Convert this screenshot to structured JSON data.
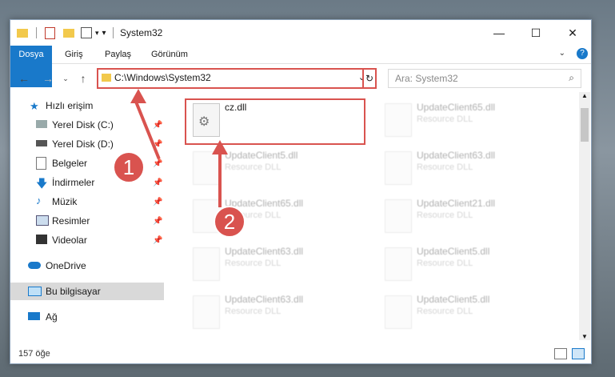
{
  "window": {
    "title": "System32"
  },
  "ribbon": {
    "tabs": [
      "Dosya",
      "Giriş",
      "Paylaş",
      "Görünüm"
    ]
  },
  "address": {
    "path": "C:\\Windows\\System32"
  },
  "search": {
    "placeholder": "Ara: System32"
  },
  "sidebar": {
    "items": [
      {
        "label": "Hızlı erişim",
        "icon": "star-icon",
        "pinned": false
      },
      {
        "label": "Yerel Disk (C:)",
        "icon": "drive-icon",
        "pinned": true
      },
      {
        "label": "Yerel Disk (D:)",
        "icon": "drive-icon",
        "pinned": true
      },
      {
        "label": "Belgeler",
        "icon": "document-icon",
        "pinned": true
      },
      {
        "label": "İndirmeler",
        "icon": "download-icon",
        "pinned": true
      },
      {
        "label": "Müzik",
        "icon": "music-icon",
        "pinned": true
      },
      {
        "label": "Resimler",
        "icon": "picture-icon",
        "pinned": true
      },
      {
        "label": "Videolar",
        "icon": "video-icon",
        "pinned": true
      },
      {
        "label": "OneDrive",
        "icon": "cloud-icon",
        "pinned": false
      },
      {
        "label": "Bu bilgisayar",
        "icon": "computer-icon",
        "pinned": false,
        "selected": true
      },
      {
        "label": "Ağ",
        "icon": "network-icon",
        "pinned": false
      }
    ]
  },
  "files": [
    {
      "name": "cz.dll",
      "type": ""
    },
    {
      "name": "UpdateClient65.dll",
      "type": "Resource DLL"
    },
    {
      "name": "UpdateClient5.dll",
      "type": "Resource DLL"
    },
    {
      "name": "UpdateClient63.dll",
      "type": "Resource DLL"
    },
    {
      "name": "UpdateClient65.dll",
      "type": "Resource DLL"
    },
    {
      "name": "UpdateClient21.dll",
      "type": "Resource DLL"
    },
    {
      "name": "UpdateClient63.dll",
      "type": "Resource DLL"
    },
    {
      "name": "UpdateClient5.dll",
      "type": "Resource DLL"
    },
    {
      "name": "UpdateClient63.dll",
      "type": "Resource DLL"
    },
    {
      "name": "UpdateClient5.dll",
      "type": "Resource DLL"
    }
  ],
  "status": {
    "count": "157 öğe"
  },
  "markers": {
    "one": "1",
    "two": "2"
  },
  "colors": {
    "accent": "#1979ca",
    "highlight": "#d9534f"
  }
}
